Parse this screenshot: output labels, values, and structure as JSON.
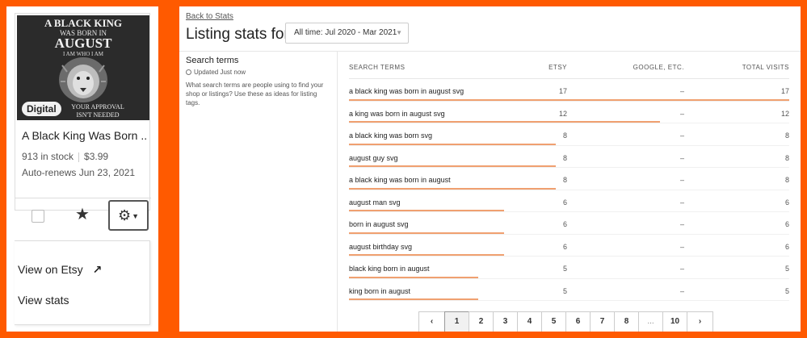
{
  "listing_card": {
    "image_text": {
      "line1": "A BLACK KING",
      "line2": "WAS BORN IN",
      "line3": "AUGUST",
      "line4": "I AM WHO I AM",
      "line5": "YOUR APPROVAL",
      "line6": "ISN'T NEEDED"
    },
    "badge": "Digital",
    "title": "A Black King Was Born ...",
    "stock": "913 in stock",
    "price": "$3.99",
    "renewal": "Auto-renews Jun 23, 2021",
    "star_icon": "star-icon",
    "gear_icon": "gear-icon"
  },
  "dropdown": {
    "items": [
      {
        "label": "View on Etsy",
        "icon": "external-link-icon"
      },
      {
        "label": "View stats"
      }
    ]
  },
  "stats": {
    "back_link": "Back to Stats",
    "title": "Listing stats for",
    "range": "All time: Jul 2020 - Mar 2021",
    "section_title": "Search terms",
    "updated": "Updated Just now",
    "description": "What search terms are people using to find your shop or listings? Use these as ideas for listing tags.",
    "columns": [
      "SEARCH TERMS",
      "ETSY",
      "GOOGLE, ETC.",
      "TOTAL VISITS"
    ],
    "max_visits": 17,
    "bar_color": "#f0a070",
    "rows": [
      {
        "term": "a black king was born in august svg",
        "etsy": "17",
        "google": "–",
        "total": "17",
        "value": 17
      },
      {
        "term": "a king was born in august svg",
        "etsy": "12",
        "google": "–",
        "total": "12",
        "value": 12
      },
      {
        "term": "a black king was born svg",
        "etsy": "8",
        "google": "–",
        "total": "8",
        "value": 8
      },
      {
        "term": "august guy svg",
        "etsy": "8",
        "google": "–",
        "total": "8",
        "value": 8
      },
      {
        "term": "a black king was born in august",
        "etsy": "8",
        "google": "–",
        "total": "8",
        "value": 8
      },
      {
        "term": "august man svg",
        "etsy": "6",
        "google": "–",
        "total": "6",
        "value": 6
      },
      {
        "term": "born in august svg",
        "etsy": "6",
        "google": "–",
        "total": "6",
        "value": 6
      },
      {
        "term": "august birthday svg",
        "etsy": "6",
        "google": "–",
        "total": "6",
        "value": 6
      },
      {
        "term": "black king born in august",
        "etsy": "5",
        "google": "–",
        "total": "5",
        "value": 5
      },
      {
        "term": "king born in august",
        "etsy": "5",
        "google": "–",
        "total": "5",
        "value": 5
      }
    ],
    "pagination": {
      "prev_icon": "chevron-left-icon",
      "next_icon": "chevron-right-icon",
      "pages": [
        "1",
        "2",
        "3",
        "4",
        "5",
        "6",
        "7",
        "8",
        "...",
        "10"
      ],
      "current": "1"
    }
  },
  "colors": {
    "frame": "#ff5a00",
    "accent_bar": "#f0a070"
  }
}
